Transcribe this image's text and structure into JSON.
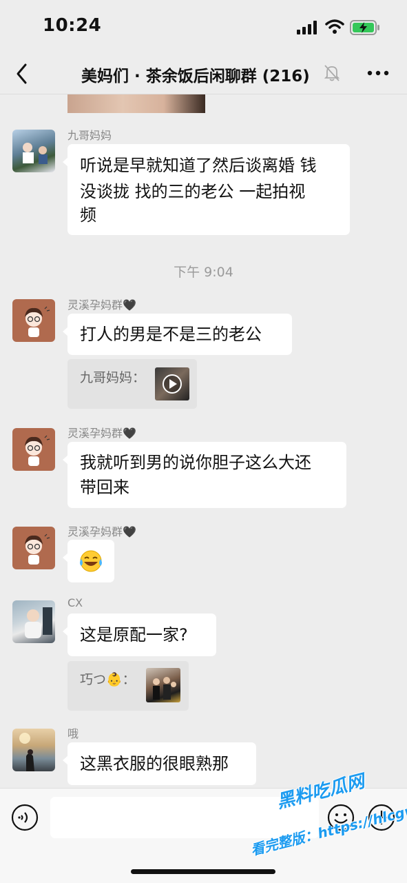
{
  "status_bar": {
    "time": "10:24"
  },
  "header": {
    "title": "美妈们 · 茶余饭后闲聊群 (216)"
  },
  "messages": [
    {
      "sender": "九哥妈妈",
      "lines": [
        "听说是早就知道了然后谈离婚 钱",
        "没谈拢 找的三的老公 一起拍视",
        "频"
      ]
    },
    {
      "sender": "灵溪孕妈群🖤",
      "lines": [
        "打人的男是不是三的老公"
      ],
      "quote_name": "九哥妈妈："
    },
    {
      "sender": "灵溪孕妈群🖤",
      "lines": [
        "我就听到男的说你胆子这么大还",
        "带回来"
      ]
    },
    {
      "sender": "灵溪孕妈群🖤",
      "emoji": "😂"
    },
    {
      "sender": "CX",
      "lines": [
        "这是原配一家?"
      ],
      "quote_name": "巧つ👶："
    },
    {
      "sender": "哦",
      "lines": [
        "这黑衣服的很眼熟那"
      ]
    }
  ],
  "timestamp": "下午 9:04",
  "watermark": {
    "line1": "黑料吃瓜网",
    "line2": "看完整版：https://hlcgw.co"
  }
}
